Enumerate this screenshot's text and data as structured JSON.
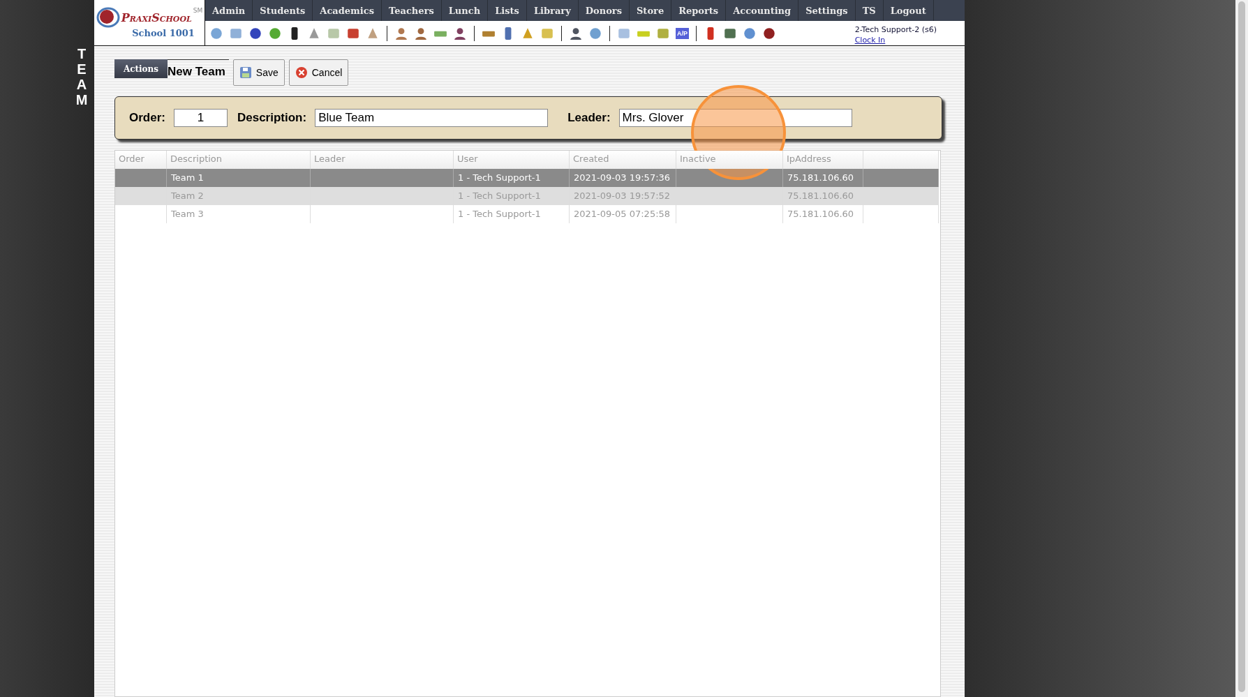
{
  "side_title": "TEAM",
  "logo": {
    "name": "PraxiSchool",
    "service_mark": "SM",
    "school": "School 1001"
  },
  "menu": [
    {
      "label": "Admin"
    },
    {
      "label": "Students"
    },
    {
      "label": "Academics"
    },
    {
      "label": "Teachers"
    },
    {
      "label": "Lunch"
    },
    {
      "label": "Lists"
    },
    {
      "label": "Library"
    },
    {
      "label": "Donors"
    },
    {
      "label": "Store"
    },
    {
      "label": "Reports"
    },
    {
      "label": "Accounting"
    },
    {
      "label": "Settings"
    },
    {
      "label": "TS"
    },
    {
      "label": "Logout"
    }
  ],
  "toolbar": {
    "ap_badge": "A/P"
  },
  "user": {
    "name": "2-Tech Support-2 (s6)",
    "clock_link": "Clock In"
  },
  "actions": {
    "tab": "Actions",
    "title": "New Team",
    "buttons": [
      {
        "kind": "save",
        "label": "Save"
      },
      {
        "kind": "cancel",
        "label": "Cancel"
      }
    ]
  },
  "form": [
    {
      "label": "Order:",
      "value": "1",
      "kind": "short"
    },
    {
      "label": "Description:",
      "value": "Blue Team",
      "kind": "wide"
    },
    {
      "label": "Leader:",
      "value": "Mrs. Glover",
      "kind": "wide"
    }
  ],
  "table": {
    "columns": [
      "Order",
      "Description",
      "Leader",
      "User",
      "Created",
      "Inactive",
      "IpAddress"
    ],
    "rows": [
      {
        "selected": true,
        "cells": [
          "",
          "Team 1",
          "",
          "1 - Tech Support-1",
          "2021-09-03 19:57:36",
          "",
          "75.181.106.60"
        ]
      },
      {
        "selected": false,
        "cells": [
          "",
          "Team 2",
          "",
          "1 - Tech Support-1",
          "2021-09-03 19:57:52",
          "",
          "75.181.106.60"
        ]
      },
      {
        "selected": false,
        "cells": [
          "",
          "Team 3",
          "",
          "1 - Tech Support-1",
          "2021-09-05 07:25:58",
          "",
          "75.181.106.60"
        ]
      }
    ]
  }
}
